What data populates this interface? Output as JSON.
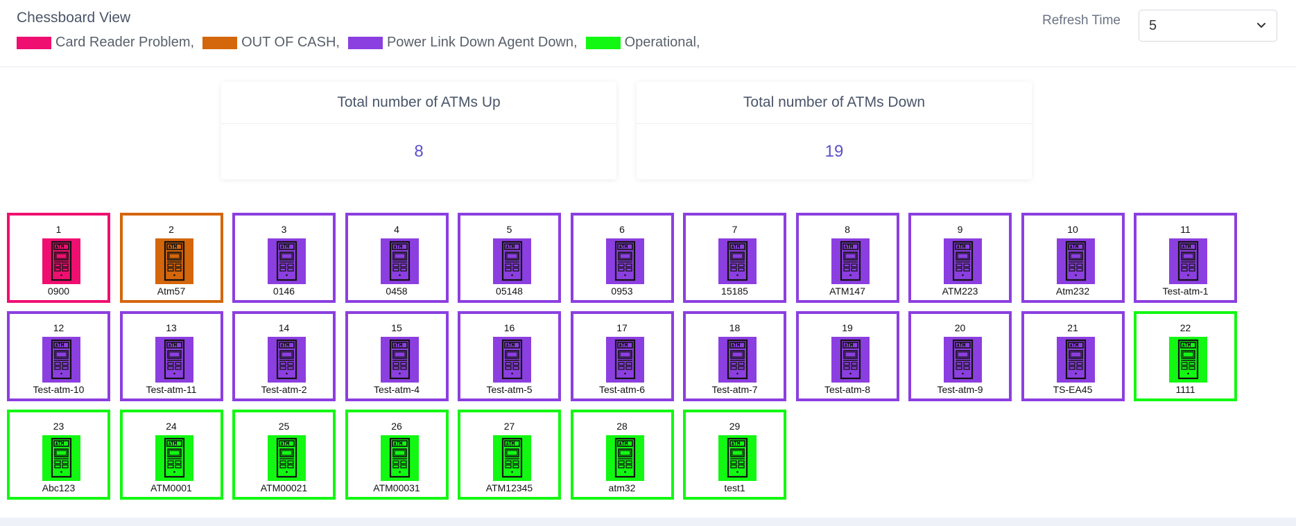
{
  "header": {
    "title": "Chessboard View",
    "refresh_label": "Refresh Time",
    "refresh_value": "5"
  },
  "legend": [
    {
      "label": "Card Reader Problem,",
      "color": "#ef0f71"
    },
    {
      "label": "OUT OF CASH,",
      "color": "#d4660b"
    },
    {
      "label": "Power Link Down Agent Down,",
      "color": "#8c3fe0"
    },
    {
      "label": "Operational,",
      "color": "#12f812"
    }
  ],
  "stats": {
    "up_title": "Total number of ATMs Up",
    "up_value": "8",
    "down_title": "Total number of ATMs Down",
    "down_value": "19"
  },
  "icon": "atm-icon",
  "atms": [
    {
      "num": "1",
      "name": "0900",
      "status": "card"
    },
    {
      "num": "2",
      "name": "Atm57",
      "status": "cash"
    },
    {
      "num": "3",
      "name": "0146",
      "status": "power"
    },
    {
      "num": "4",
      "name": "0458",
      "status": "power"
    },
    {
      "num": "5",
      "name": "05148",
      "status": "power"
    },
    {
      "num": "6",
      "name": "0953",
      "status": "power"
    },
    {
      "num": "7",
      "name": "15185",
      "status": "power"
    },
    {
      "num": "8",
      "name": "ATM147",
      "status": "power"
    },
    {
      "num": "9",
      "name": "ATM223",
      "status": "power"
    },
    {
      "num": "10",
      "name": "Atm232",
      "status": "power"
    },
    {
      "num": "11",
      "name": "Test-atm-1",
      "status": "power"
    },
    {
      "num": "12",
      "name": "Test-atm-10",
      "status": "power"
    },
    {
      "num": "13",
      "name": "Test-atm-11",
      "status": "power"
    },
    {
      "num": "14",
      "name": "Test-atm-2",
      "status": "power"
    },
    {
      "num": "15",
      "name": "Test-atm-4",
      "status": "power"
    },
    {
      "num": "16",
      "name": "Test-atm-5",
      "status": "power"
    },
    {
      "num": "17",
      "name": "Test-atm-6",
      "status": "power"
    },
    {
      "num": "18",
      "name": "Test-atm-7",
      "status": "power"
    },
    {
      "num": "19",
      "name": "Test-atm-8",
      "status": "power"
    },
    {
      "num": "20",
      "name": "Test-atm-9",
      "status": "power"
    },
    {
      "num": "21",
      "name": "TS-EA45",
      "status": "power"
    },
    {
      "num": "22",
      "name": "1111",
      "status": "ok"
    },
    {
      "num": "23",
      "name": "Abc123",
      "status": "ok"
    },
    {
      "num": "24",
      "name": "ATM0001",
      "status": "ok"
    },
    {
      "num": "25",
      "name": "ATM00021",
      "status": "ok"
    },
    {
      "num": "26",
      "name": "ATM00031",
      "status": "ok"
    },
    {
      "num": "27",
      "name": "ATM12345",
      "status": "ok"
    },
    {
      "num": "28",
      "name": "atm32",
      "status": "ok"
    },
    {
      "num": "29",
      "name": "test1",
      "status": "ok"
    }
  ],
  "status_colors": {
    "card": "#ef0f71",
    "cash": "#d4660b",
    "power": "#8c3fe0",
    "ok": "#12f812"
  }
}
